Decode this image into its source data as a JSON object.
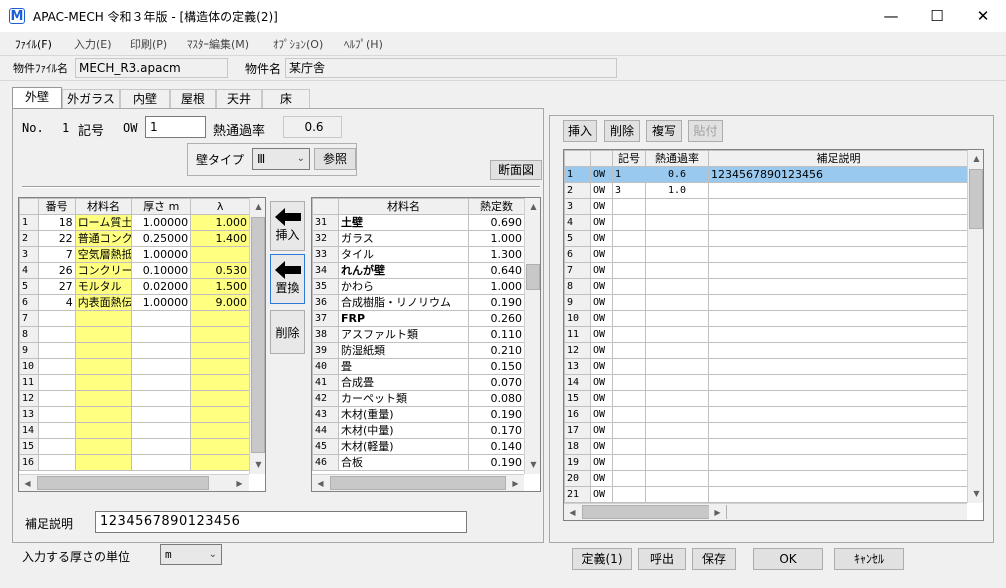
{
  "window": {
    "title": "APAC-MECH 令和３年版 - [構造体の定義(2)]",
    "icon": "M",
    "minimize": "—",
    "maximize": "☐",
    "close": "✕"
  },
  "menu": [
    "ﾌｧｲﾙ(F)",
    "入力(E)",
    "印刷(P)",
    "ﾏｽﾀｰ編集(M)",
    "ｵﾌﾟｼｮﾝ(O)",
    "ﾍﾙﾌﾟ(H)"
  ],
  "info": {
    "file_label": "物件ﾌｧｲﾙ名",
    "file_value": "MECH_R3.apacm",
    "name_label": "物件名",
    "name_value": "某庁舎"
  },
  "tabs": [
    "外壁",
    "外ガラス",
    "内壁",
    "屋根",
    "天井",
    "床"
  ],
  "header": {
    "no_label": "No.",
    "no_value": "1",
    "code_label": "記号",
    "code_prefix": "OW",
    "code_value": "1",
    "k_label": "熱通過率",
    "k_value": "0.6",
    "wall_type_label": "壁タイプ",
    "wall_type_value": "Ⅲ",
    "ref_button": "参照",
    "section_button": "断面図"
  },
  "layer_table": {
    "headers": [
      "番号",
      "材料名",
      "厚さ m",
      "λ"
    ],
    "rows": [
      {
        "r": "1",
        "no": "18",
        "name": "ローム質土",
        "t": "1.00000",
        "l": "1.000"
      },
      {
        "r": "2",
        "no": "22",
        "name": "普通コンク",
        "t": "0.25000",
        "l": "1.400"
      },
      {
        "r": "3",
        "no": "7",
        "name": "空気層熱抵",
        "t": "1.00000",
        "l": ""
      },
      {
        "r": "4",
        "no": "26",
        "name": "コンクリー",
        "t": "0.10000",
        "l": "0.530"
      },
      {
        "r": "5",
        "no": "27",
        "name": "モルタル",
        "t": "0.02000",
        "l": "1.500"
      },
      {
        "r": "6",
        "no": "4",
        "name": "内表面熱伝",
        "t": "1.00000",
        "l": "9.000"
      },
      {
        "r": "7",
        "no": "",
        "name": "",
        "t": "",
        "l": ""
      },
      {
        "r": "8",
        "no": "",
        "name": "",
        "t": "",
        "l": ""
      },
      {
        "r": "9",
        "no": "",
        "name": "",
        "t": "",
        "l": ""
      },
      {
        "r": "10",
        "no": "",
        "name": "",
        "t": "",
        "l": ""
      },
      {
        "r": "11",
        "no": "",
        "name": "",
        "t": "",
        "l": ""
      },
      {
        "r": "12",
        "no": "",
        "name": "",
        "t": "",
        "l": ""
      },
      {
        "r": "13",
        "no": "",
        "name": "",
        "t": "",
        "l": ""
      },
      {
        "r": "14",
        "no": "",
        "name": "",
        "t": "",
        "l": ""
      },
      {
        "r": "15",
        "no": "",
        "name": "",
        "t": "",
        "l": ""
      },
      {
        "r": "16",
        "no": "",
        "name": "",
        "t": "",
        "l": ""
      }
    ]
  },
  "mid_buttons": {
    "insert": "挿入",
    "replace": "置換",
    "delete": "削除"
  },
  "material_table": {
    "headers": [
      "材料名",
      "熱定数"
    ],
    "rows": [
      {
        "r": "31",
        "name": "土壁",
        "v": "0.690",
        "bold": true
      },
      {
        "r": "32",
        "name": "ガラス",
        "v": "1.000",
        "bold": false
      },
      {
        "r": "33",
        "name": "タイル",
        "v": "1.300",
        "bold": false
      },
      {
        "r": "34",
        "name": "れんが壁",
        "v": "0.640",
        "bold": true
      },
      {
        "r": "35",
        "name": "かわら",
        "v": "1.000",
        "bold": false
      },
      {
        "r": "36",
        "name": "合成樹脂・リノリウム",
        "v": "0.190",
        "bold": false
      },
      {
        "r": "37",
        "name": "FRP",
        "v": "0.260",
        "bold": true
      },
      {
        "r": "38",
        "name": "アスファルト類",
        "v": "0.110",
        "bold": false
      },
      {
        "r": "39",
        "name": "防湿紙類",
        "v": "0.210",
        "bold": false
      },
      {
        "r": "40",
        "name": "畳",
        "v": "0.150",
        "bold": false
      },
      {
        "r": "41",
        "name": "合成畳",
        "v": "0.070",
        "bold": false
      },
      {
        "r": "42",
        "name": "カーペット類",
        "v": "0.080",
        "bold": false
      },
      {
        "r": "43",
        "name": "木材(重量)",
        "v": "0.190",
        "bold": false
      },
      {
        "r": "44",
        "name": "木材(中量)",
        "v": "0.170",
        "bold": false
      },
      {
        "r": "45",
        "name": "木材(軽量)",
        "v": "0.140",
        "bold": false
      },
      {
        "r": "46",
        "name": "合板",
        "v": "0.190",
        "bold": false
      }
    ]
  },
  "supplement": {
    "label": "補足説明",
    "value": "1234567890123456"
  },
  "unit": {
    "label": "入力する厚さの単位",
    "value": "m"
  },
  "right_toolbar": {
    "insert": "挿入",
    "delete": "削除",
    "copy": "複写",
    "paste": "貼付"
  },
  "def_table": {
    "headers": [
      "記号",
      "熱通過率",
      "補足説明"
    ],
    "rows": [
      {
        "r": "1",
        "p": "OW",
        "c": "1",
        "k": "0.6",
        "s": "1234567890123456",
        "sel": true
      },
      {
        "r": "2",
        "p": "OW",
        "c": "3",
        "k": "1.0",
        "s": ""
      },
      {
        "r": "3",
        "p": "OW",
        "c": "",
        "k": "",
        "s": ""
      },
      {
        "r": "4",
        "p": "OW",
        "c": "",
        "k": "",
        "s": ""
      },
      {
        "r": "5",
        "p": "OW",
        "c": "",
        "k": "",
        "s": ""
      },
      {
        "r": "6",
        "p": "OW",
        "c": "",
        "k": "",
        "s": ""
      },
      {
        "r": "7",
        "p": "OW",
        "c": "",
        "k": "",
        "s": ""
      },
      {
        "r": "8",
        "p": "OW",
        "c": "",
        "k": "",
        "s": ""
      },
      {
        "r": "9",
        "p": "OW",
        "c": "",
        "k": "",
        "s": ""
      },
      {
        "r": "10",
        "p": "OW",
        "c": "",
        "k": "",
        "s": ""
      },
      {
        "r": "11",
        "p": "OW",
        "c": "",
        "k": "",
        "s": ""
      },
      {
        "r": "12",
        "p": "OW",
        "c": "",
        "k": "",
        "s": ""
      },
      {
        "r": "13",
        "p": "OW",
        "c": "",
        "k": "",
        "s": ""
      },
      {
        "r": "14",
        "p": "OW",
        "c": "",
        "k": "",
        "s": ""
      },
      {
        "r": "15",
        "p": "OW",
        "c": "",
        "k": "",
        "s": ""
      },
      {
        "r": "16",
        "p": "OW",
        "c": "",
        "k": "",
        "s": ""
      },
      {
        "r": "17",
        "p": "OW",
        "c": "",
        "k": "",
        "s": ""
      },
      {
        "r": "18",
        "p": "OW",
        "c": "",
        "k": "",
        "s": ""
      },
      {
        "r": "19",
        "p": "OW",
        "c": "",
        "k": "",
        "s": ""
      },
      {
        "r": "20",
        "p": "OW",
        "c": "",
        "k": "",
        "s": ""
      },
      {
        "r": "21",
        "p": "OW",
        "c": "",
        "k": "",
        "s": ""
      }
    ]
  },
  "bottom_buttons": {
    "define": "定義(1)",
    "recall": "呼出",
    "save": "保存",
    "ok": "OK",
    "cancel": "ｷｬﾝｾﾙ"
  },
  "colors": {
    "yellow": "#ffff80",
    "selected": "#99c9ef",
    "accent": "#1c5fd6"
  }
}
